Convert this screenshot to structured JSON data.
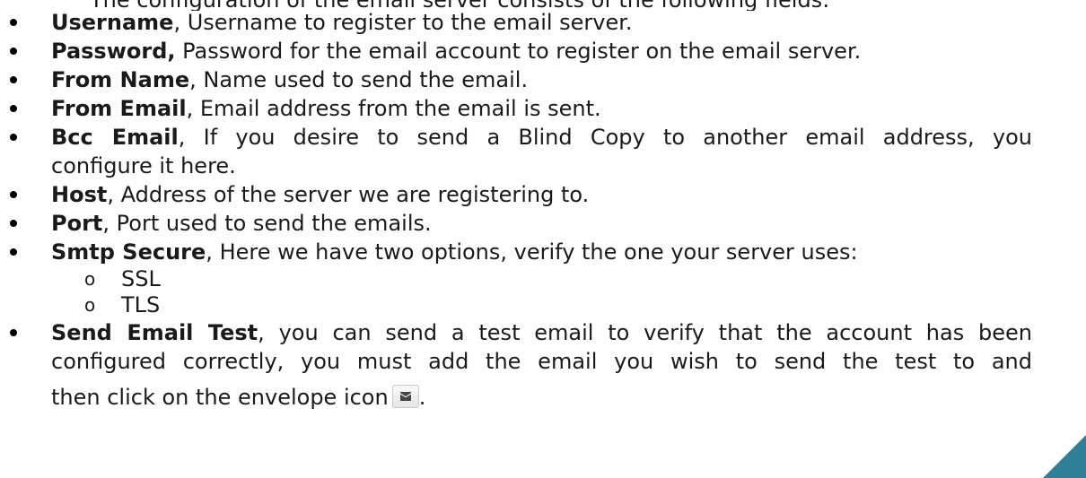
{
  "cut_line_text": "The configuration of the email server consists of the following fields:",
  "items": [
    {
      "term": "Username",
      "separator": ",",
      "text": " Username to register to the email server."
    },
    {
      "term": "Password,",
      "separator": "",
      "text": " Password for the email account to register on the email server."
    },
    {
      "term": "From Name",
      "separator": ",",
      "text": " Name used to send the email."
    },
    {
      "term": "From Email",
      "separator": ",",
      "text": " Email address from the email is sent."
    },
    {
      "term": "Bcc Email",
      "separator": ",",
      "text_line1": " If you desire to send a Blind Copy to another email address, you",
      "text_line2": "configure it here."
    },
    {
      "term": "Host",
      "separator": ",",
      "text": " Address of the server we are registering to."
    },
    {
      "term": "Port",
      "separator": ",",
      "text": " Port used to send the emails."
    },
    {
      "term": "Smtp Secure",
      "separator": ",",
      "text": " Here we have two options, verify the one your server uses:"
    },
    {
      "term": "Send Email Test",
      "separator": ",",
      "text_line1": " you can send a test email to verify that the account has been",
      "text_line2": "configured correctly, you must add the email you wish to send the test to and",
      "text_line3": "then click on the envelope icon",
      "text_end": "."
    }
  ],
  "smtp_options": [
    {
      "marker": "o",
      "label": "SSL"
    },
    {
      "marker": "o",
      "label": "TLS"
    }
  ],
  "icons": {
    "envelope": "envelope-icon",
    "corner": "corner-triangle"
  },
  "colors": {
    "corner_accent": "#2f7f96"
  }
}
